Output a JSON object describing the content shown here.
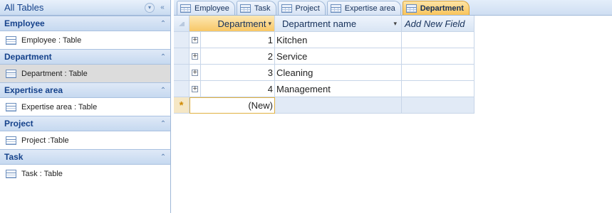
{
  "nav": {
    "title": "All Tables",
    "groups": [
      {
        "label": "Employee",
        "item": "Employee : Table"
      },
      {
        "label": "Department",
        "item": "Department : Table"
      },
      {
        "label": "Expertise area",
        "item": "Expertise area : Table"
      },
      {
        "label": "Project",
        "item": "Project :Table"
      },
      {
        "label": "Task",
        "item": "Task : Table"
      }
    ]
  },
  "tabs": [
    "Employee",
    "Task",
    "Project",
    "Expertise area",
    "Department"
  ],
  "datasheet": {
    "columns": [
      "Department",
      "Department name",
      "Add New Field"
    ],
    "rows": [
      {
        "id": "1",
        "name": "Kitchen"
      },
      {
        "id": "2",
        "name": "Service"
      },
      {
        "id": "3",
        "name": "Cleaning"
      },
      {
        "id": "4",
        "name": "Management"
      }
    ],
    "new_row_marker": "*",
    "new_row_value": "(New)"
  },
  "colors": {
    "active_tab": "#f9c45a",
    "nav_group_header": "#c6d9f0",
    "new_row_marker": "#d08a00"
  }
}
